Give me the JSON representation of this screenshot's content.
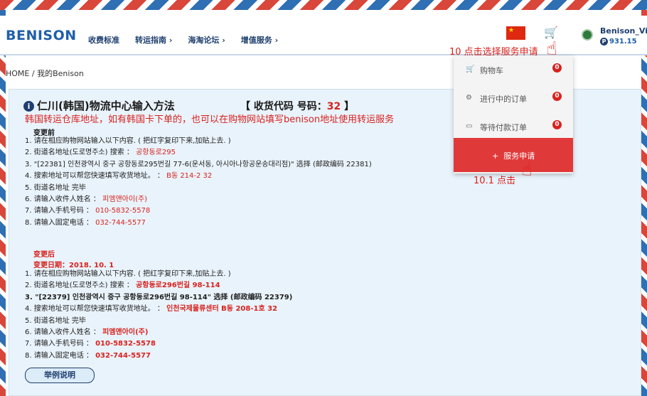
{
  "header": {
    "logo": "BENISON",
    "nav": [
      "收费标准",
      "转运指南 ›",
      "海淘论坛 ›",
      "增值服务 ›"
    ],
    "user_name": "Benison_Vi",
    "balance": "931.15",
    "balance_icon": "P"
  },
  "annotations": {
    "step10": "10 点击选择服务申请",
    "step10_1": "10.1 点击"
  },
  "breadcrumb": "HOME  /  我的Benison",
  "panel": {
    "title": "仁川(韩国)物流中心输入方法",
    "code_label": "【 收货代码 号码：",
    "code_value": "32",
    "code_close": " 】",
    "note": "韩国转运仓库地址，如有韩国卡下单的，也可以在购物网站填写benison地址使用转运服务",
    "before_label": "变更前",
    "before_steps": [
      {
        "text": "1. 请在相应购物网站输入以下内容. ( 把红字复印下来,加贴上去. )",
        "value": ""
      },
      {
        "text": "2. 街道名地址(도로명주소) 搜索 ： ",
        "value": "공항동로295"
      },
      {
        "text": "3. \"[22381] 인천광역시 중구 공항동로295번길 77-6(운서동, 아시아나항공운송대리점)\" 选择 (邮政编码 22381)",
        "value": ""
      },
      {
        "text": "4. 搜索地址可以帮您快速填写收货地址。 ： ",
        "value": "B동 214-2  32"
      },
      {
        "text": "5. 街道名地址 完毕",
        "value": ""
      },
      {
        "text": "6. 请输入收件人姓名 ： ",
        "value": "피엠앤아이(주)"
      },
      {
        "text": "7. 请输入手机号码 ： ",
        "value": "010-5832-5578"
      },
      {
        "text": "8. 请输入固定电话 ： ",
        "value": "032-744-5577"
      }
    ],
    "after_label": "变更后",
    "after_date": "变更日期：2018. 10. 1",
    "after_steps": [
      {
        "text": "1. 请在相应购物网站输入以下内容. ( 把红字复印下来,加贴上去. )",
        "value": ""
      },
      {
        "text": "2. 街道名地址(도로명주소) 搜索 ： ",
        "value": "공항동로296번길 98-114"
      },
      {
        "text": "3. \"[22379] 인천광역시 중구 공항동로296번길 98-114\" 选择 (邮政编码 22379)",
        "value": ""
      },
      {
        "text": "4. 搜索地址可以帮您快速填写收货地址。 ： ",
        "value": "인천국제물류센터 B동 208-1호  32"
      },
      {
        "text": "5. 街道名地址 完毕",
        "value": ""
      },
      {
        "text": "6. 请输入收件人姓名 ： ",
        "value": "피엠앤아이(주)"
      },
      {
        "text": "7. 请输入手机号码 ： ",
        "value": "010-5832-5578"
      },
      {
        "text": "8. 请输入固定电话 ： ",
        "value": "032-744-5577"
      }
    ],
    "example_button": "举例说明"
  },
  "dropdown": {
    "items": [
      {
        "label": "购物车",
        "badge": "0",
        "icon": "cart-icon"
      },
      {
        "label": "进行中的订单",
        "badge": "0",
        "icon": "gears-icon"
      },
      {
        "label": "等待付款订单",
        "badge": "0",
        "icon": "card-icon"
      }
    ],
    "apply": "服务申请"
  },
  "colors": {
    "accent_red": "#d8221e",
    "brand_blue": "#1f5fa8",
    "panel_bg": "#e9f3fb",
    "apply_bg": "#e0393a"
  }
}
